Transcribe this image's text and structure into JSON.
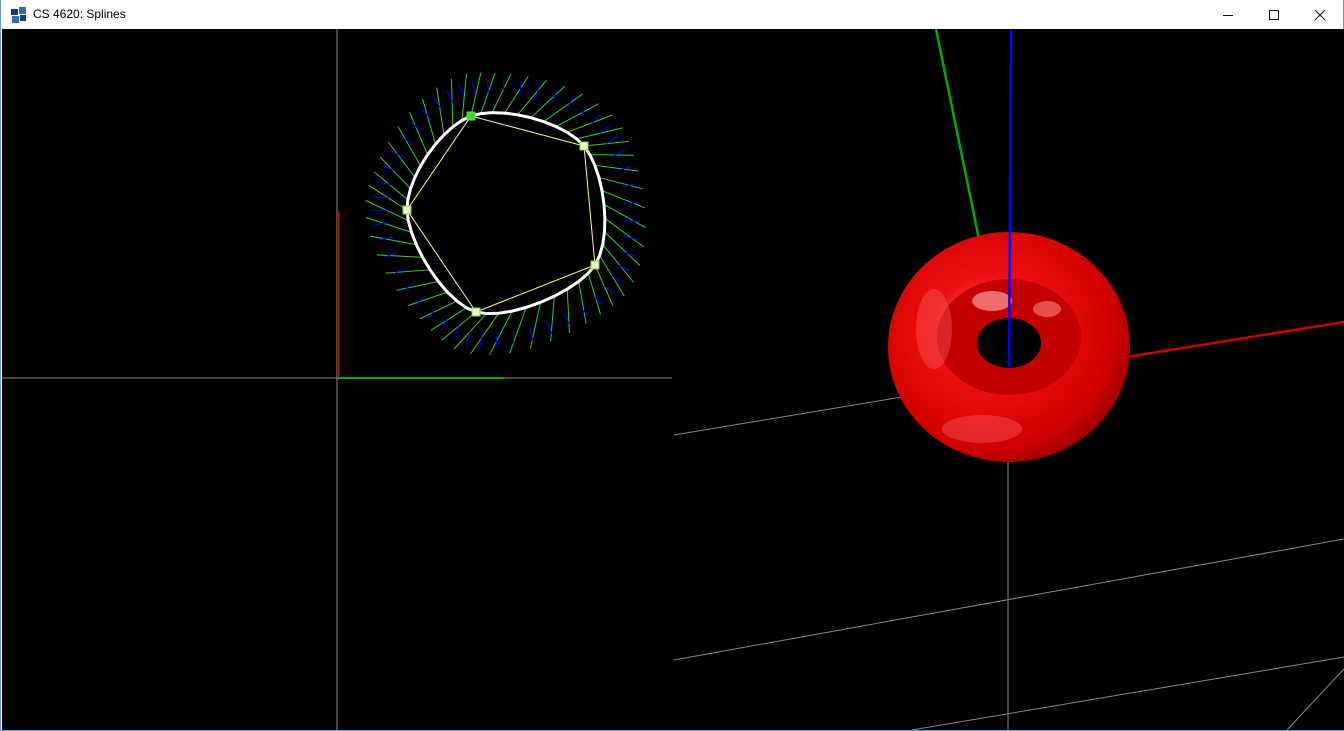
{
  "window": {
    "title": "CS 4620: Splines",
    "controls": {
      "minimize": "minimize",
      "maximize": "maximize",
      "close": "close"
    }
  },
  "colors": {
    "background": "#000000",
    "axis_x": "#cc0000",
    "axis_y": "#00aa00",
    "axis_z": "#0000ff",
    "grid": "#888888",
    "curve": "#ffffff",
    "control_polygon": "#ffff66",
    "tangent": "#33cc33",
    "normal": "#0000ff",
    "torus": "#e00000"
  },
  "icons": {
    "app": "app-window-icon",
    "minimize": "minimize-icon",
    "maximize": "maximize-icon",
    "close": "close-icon"
  }
}
